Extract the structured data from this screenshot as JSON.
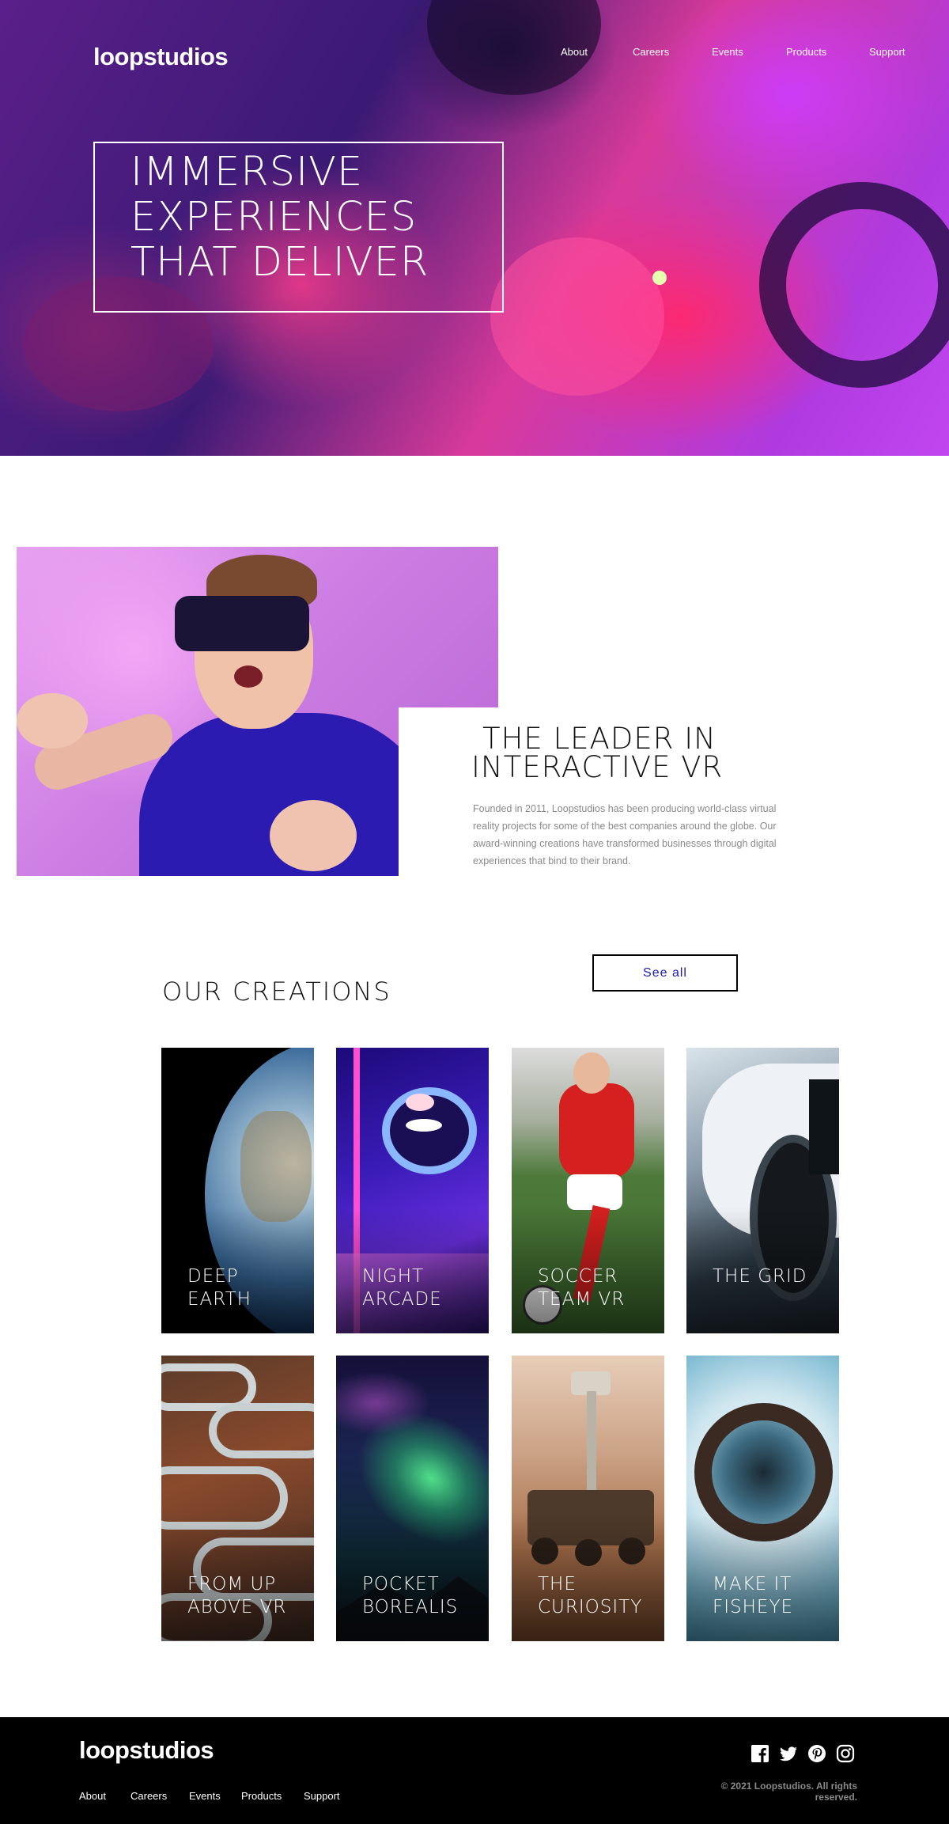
{
  "brand": {
    "logo_text": "loopstudios"
  },
  "header": {
    "nav": [
      "About",
      "Careers",
      "Events",
      "Products",
      "Support"
    ]
  },
  "hero": {
    "title_lines": [
      "IMMERSIVE",
      "EXPERIENCES",
      "THAT DELIVER"
    ]
  },
  "interactive": {
    "title_lines": [
      "THE LEADER IN",
      "INTERACTIVE VR"
    ],
    "text": "Founded in 2011, Loopstudios has been producing world-class virtual reality projects for some of the best companies around the globe. Our award-winning creations have transformed businesses through digital experiences that bind to their brand."
  },
  "creations": {
    "title": "OUR CREATIONS",
    "see_all_label": "See all",
    "items": [
      {
        "lines": [
          "DEEP",
          "EARTH"
        ]
      },
      {
        "lines": [
          "NIGHT",
          "ARCADE"
        ]
      },
      {
        "lines": [
          "SOCCER",
          "TEAM VR"
        ]
      },
      {
        "lines": [
          "THE GRID"
        ]
      },
      {
        "lines": [
          "FROM UP",
          "ABOVE VR"
        ]
      },
      {
        "lines": [
          "POCKET",
          "BOREALIS"
        ]
      },
      {
        "lines": [
          "THE",
          "CURIOSITY"
        ]
      },
      {
        "lines": [
          "MAKE IT",
          "FISHEYE"
        ]
      }
    ]
  },
  "footer": {
    "logo_text": "loopstudios",
    "nav": [
      "About",
      "Careers",
      "Events",
      "Products",
      "Support"
    ],
    "social_icons": [
      "facebook-icon",
      "twitter-icon",
      "pinterest-icon",
      "instagram-icon"
    ],
    "copyright": "© 2021 Loopstudios. All rights reserved."
  },
  "colors": {
    "accent": "#1d1ab5",
    "text_muted": "#8a8a8a",
    "footer_bg": "#000000"
  }
}
